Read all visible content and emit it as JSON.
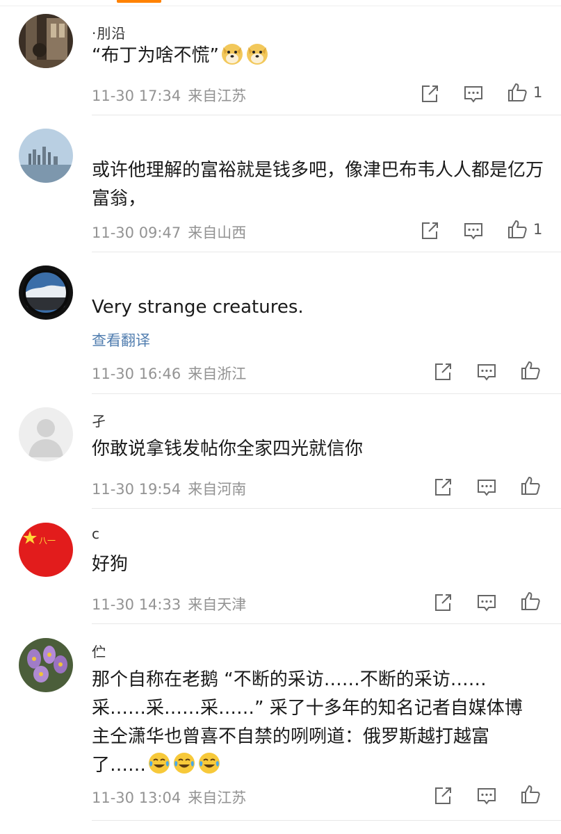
{
  "comments": [
    {
      "username": "·刖沿",
      "text": "“布丁为啥不慌”",
      "emojis": [
        "doge-emoji",
        "doge-emoji"
      ],
      "date": "11-30 17:34",
      "location": "来自江苏",
      "likes": "1"
    },
    {
      "username": "",
      "text": "或许他理解的富裕就是钱多吧，像津巴布韦人人都是亿万富翁，",
      "date": "11-30 09:47",
      "location": "来自山西",
      "likes": "1"
    },
    {
      "username": "",
      "text": "Very strange creatures.",
      "translate": "查看翻译",
      "date": "11-30 16:46",
      "location": "来自浙江",
      "likes": ""
    },
    {
      "username": "孑",
      "text": "你敢说拿钱发帖你全家四光就信你",
      "date": "11-30 19:54",
      "location": "来自河南",
      "likes": ""
    },
    {
      "username": "c",
      "avatar_text": "八一",
      "text": "好狗",
      "date": "11-30 14:33",
      "location": "来自天津",
      "likes": ""
    },
    {
      "username": "伫",
      "text": "那个自称在老鹅 “不断的采访……不断的采访……采……采……采……” 采了十多年的知名记者自媒体博主仝潇华也曾喜不自禁的咧咧道：俄罗斯越打越富了……",
      "emojis": [
        "laugh-cry-emoji",
        "laugh-cry-emoji",
        "laugh-cry-emoji"
      ],
      "date": "11-30 13:04",
      "location": "来自江苏",
      "likes": ""
    }
  ],
  "colors": {
    "accent": "#ff8200",
    "meta": "#939393",
    "link": "#507daf",
    "icon": "#666666"
  }
}
